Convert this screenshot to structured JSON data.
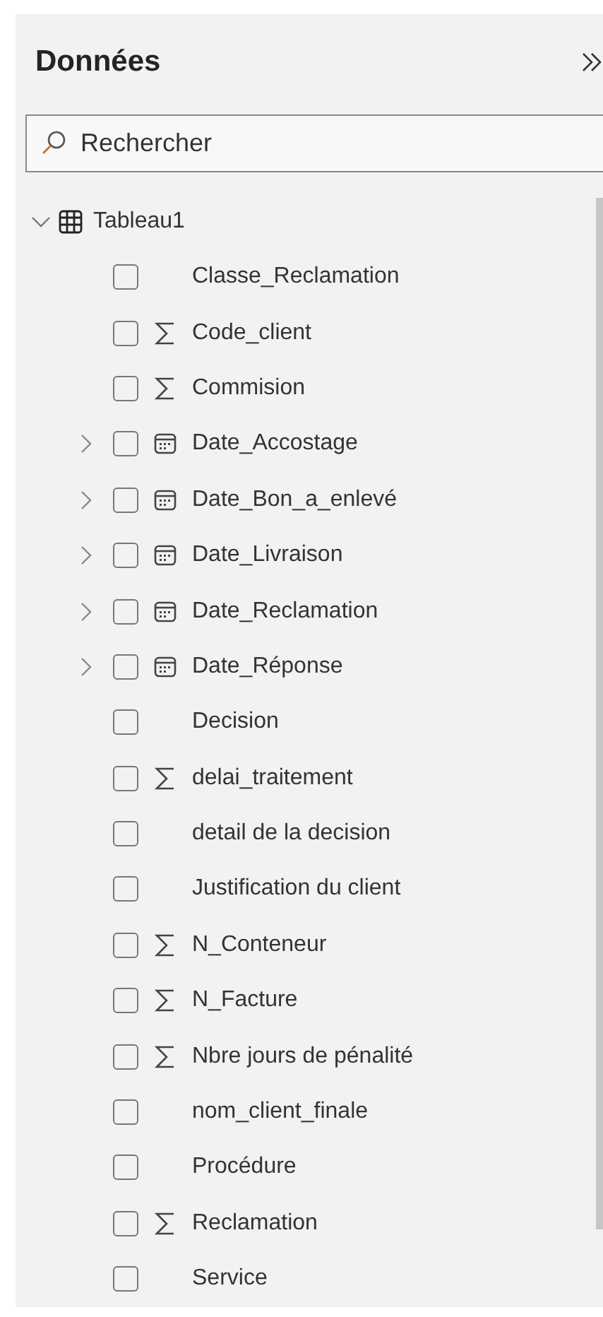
{
  "panel": {
    "title": "Données"
  },
  "search": {
    "placeholder": "Rechercher"
  },
  "table": {
    "name": "Tableau1",
    "expanded": true,
    "fields": [
      {
        "name": "Classe_Reclamation",
        "kind": "text",
        "checked": false
      },
      {
        "name": "Code_client",
        "kind": "sum",
        "checked": false
      },
      {
        "name": "Commision",
        "kind": "sum",
        "checked": false
      },
      {
        "name": "Date_Accostage",
        "kind": "date",
        "checked": false,
        "expanded": false
      },
      {
        "name": "Date_Bon_a_enlevé",
        "kind": "date",
        "checked": false,
        "expanded": false
      },
      {
        "name": "Date_Livraison",
        "kind": "date",
        "checked": false,
        "expanded": false
      },
      {
        "name": "Date_Reclamation",
        "kind": "date",
        "checked": false,
        "expanded": false
      },
      {
        "name": "Date_Réponse",
        "kind": "date",
        "checked": false,
        "expanded": false
      },
      {
        "name": "Decision",
        "kind": "text",
        "checked": false
      },
      {
        "name": "delai_traitement",
        "kind": "sum",
        "checked": false
      },
      {
        "name": "detail de la decision",
        "kind": "text",
        "checked": false
      },
      {
        "name": "Justification du client",
        "kind": "text",
        "checked": false
      },
      {
        "name": "N_Conteneur",
        "kind": "sum",
        "checked": false
      },
      {
        "name": "N_Facture",
        "kind": "sum",
        "checked": false
      },
      {
        "name": "Nbre jours de pénalité",
        "kind": "sum",
        "checked": false
      },
      {
        "name": "nom_client_finale",
        "kind": "text",
        "checked": false
      },
      {
        "name": "Procédure",
        "kind": "text",
        "checked": false
      },
      {
        "name": "Reclamation",
        "kind": "sum",
        "checked": false
      },
      {
        "name": "Service",
        "kind": "text",
        "checked": false
      }
    ]
  }
}
